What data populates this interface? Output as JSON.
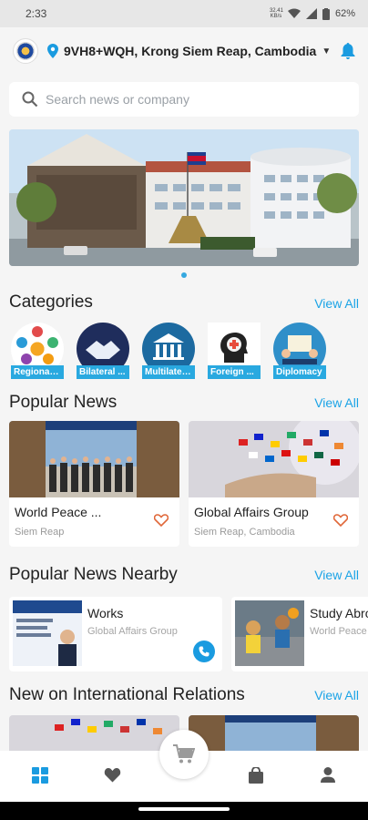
{
  "status_bar": {
    "time": "2:33",
    "battery": "62%",
    "data_rate": "32.41 KB/s"
  },
  "header": {
    "location": "9VH8+WQH, Krong Siem Reap, Cambodia"
  },
  "search": {
    "placeholder": "Search news or company"
  },
  "sections": {
    "categories": "Categories",
    "popular_news": "Popular News",
    "nearby": "Popular News Nearby",
    "international": "New on International Relations",
    "view_all": "View All"
  },
  "categories": [
    {
      "label": "Regional ..."
    },
    {
      "label": "Bilateral ..."
    },
    {
      "label": "Multilater..."
    },
    {
      "label": "Foreign ..."
    },
    {
      "label": "Diplomacy"
    }
  ],
  "popular_news": [
    {
      "title": "World Peace ...",
      "location": "Siem Reap"
    },
    {
      "title": "Global Affairs Group",
      "location": "Siem Reap, Cambodia"
    }
  ],
  "nearby": [
    {
      "title": "Works",
      "subtitle": "Global Affairs Group"
    },
    {
      "title": "Study Abro",
      "subtitle": "World Peace"
    }
  ],
  "colors": {
    "accent": "#1aa3e6",
    "category_label": "#29a9e0",
    "heart": "#e0683a"
  }
}
